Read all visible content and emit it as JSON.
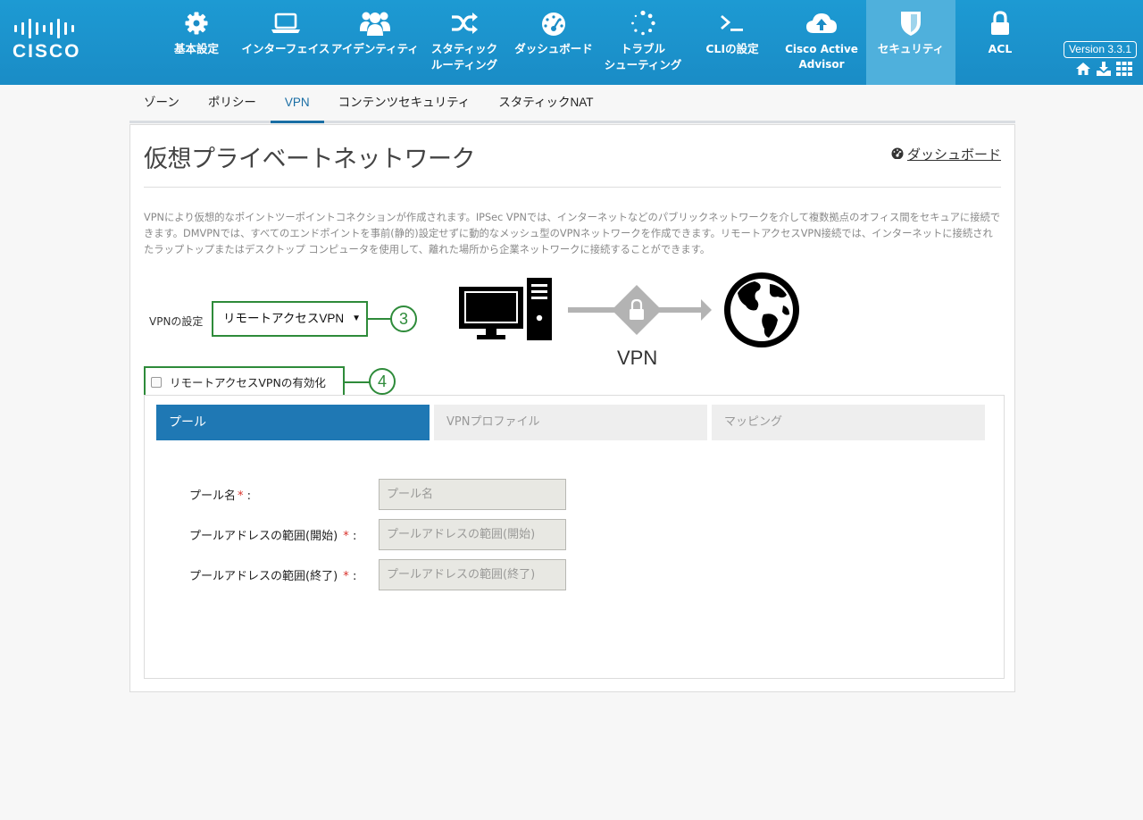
{
  "brand": {
    "logo_text": "CISCO"
  },
  "nav": [
    {
      "label": "基本設定",
      "icon": "gear-icon"
    },
    {
      "label": "インターフェイス",
      "icon": "laptop-icon"
    },
    {
      "label": "アイデンティティ",
      "icon": "users-icon"
    },
    {
      "label": "スタティック\nルーティング",
      "icon": "shuffle-icon"
    },
    {
      "label": "ダッシュボード",
      "icon": "dashboard-icon"
    },
    {
      "label": "トラブル\nシューティング",
      "icon": "spinner-icon"
    },
    {
      "label": "CLIの設定",
      "icon": "terminal-icon"
    },
    {
      "label": "Cisco Active\nAdvisor",
      "icon": "cloud-upload-icon"
    },
    {
      "label": "セキュリティ",
      "icon": "shield-icon",
      "active": true
    },
    {
      "label": "ACL",
      "icon": "lock-icon"
    }
  ],
  "version": "Version 3.3.1",
  "subtabs": [
    {
      "label": "ゾーン"
    },
    {
      "label": "ポリシー"
    },
    {
      "label": "VPN",
      "active": true
    },
    {
      "label": "コンテンツセキュリティ"
    },
    {
      "label": "スタティックNAT"
    }
  ],
  "page": {
    "title": "仮想プライベートネットワーク",
    "dashboard_link": "ダッシュボード",
    "description": "VPNにより仮想的なポイントツーポイントコネクションが作成されます。IPSec VPNでは、インターネットなどのパブリックネットワークを介して複数拠点のオフィス間をセキュアに接続できます。DMVPNでは、すべてのエンドポイントを事前(静的)設定せずに動的なメッシュ型のVPNネットワークを作成できます。リモートアクセスVPN接続では、インターネットに接続されたラップトップまたはデスクトップ コンピュータを使用して、離れた場所から企業ネットワークに接続することができます。"
  },
  "vpn_config": {
    "label": "VPNの設定",
    "selected": "リモートアクセスVPN",
    "callout": "3"
  },
  "diagram": {
    "label": "VPN"
  },
  "enable": {
    "label": "リモートアクセスVPNの有効化",
    "checked": false,
    "callout": "4"
  },
  "inner_tabs": [
    {
      "label": "プール",
      "active": true
    },
    {
      "label": "VPNプロファイル"
    },
    {
      "label": "マッピング"
    }
  ],
  "form": {
    "required_mark": "*",
    "colon": ":",
    "fields": [
      {
        "label": "プール名",
        "placeholder": "プール名"
      },
      {
        "label": "プールアドレスの範囲(開始)",
        "placeholder": "プールアドレスの範囲(開始)"
      },
      {
        "label": "プールアドレスの範囲(終了)",
        "placeholder": "プールアドレスの範囲(終了)"
      }
    ]
  },
  "colors": {
    "header": "#1a8cc6",
    "active_tab": "#1f78b4",
    "callout_green": "#2e8b3a",
    "required_red": "#d9322b"
  }
}
